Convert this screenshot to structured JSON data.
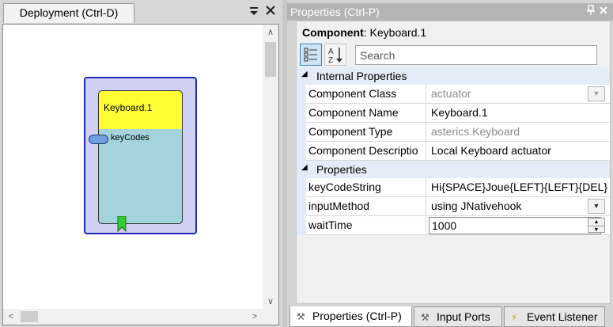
{
  "deployment": {
    "tab_label": "Deployment (Ctrl-D)",
    "pin_icon": "pin-dropdown-icon",
    "close_icon": "close-icon",
    "component": {
      "title": "Keyboard.1",
      "port_label": "keyCodes",
      "colors": {
        "frame": "#1e28b4",
        "title_bg": "#ffff33",
        "body_bg": "#a3d3dc",
        "event_marker": "#33cc33"
      }
    }
  },
  "properties": {
    "header_title": "Properties (Ctrl-P)",
    "component_label": "Component",
    "component_value": ": Keyboard.1",
    "search_placeholder": "Search",
    "sections": {
      "internal": {
        "label": "Internal Properties",
        "rows": [
          {
            "name": "Component Class",
            "value": "actuator"
          },
          {
            "name": "Component Name",
            "value": "Keyboard.1"
          },
          {
            "name": "Component Type",
            "value": "asterics.Keyboard"
          },
          {
            "name": "Component Descriptio",
            "value": "Local Keyboard actuator"
          }
        ]
      },
      "props": {
        "label": "Properties",
        "rows": [
          {
            "name": "keyCodeString",
            "value": "Hi{SPACE}Joue{LEFT}{LEFT}{DEL}"
          },
          {
            "name": "inputMethod",
            "value": "using JNativehook"
          },
          {
            "name": "waitTime",
            "value": "1000"
          }
        ]
      }
    }
  },
  "tabs": [
    {
      "label": "Properties (Ctrl-P)",
      "active": true
    },
    {
      "label": "Input Ports",
      "active": false
    },
    {
      "label": "Event Listener",
      "active": false
    }
  ]
}
